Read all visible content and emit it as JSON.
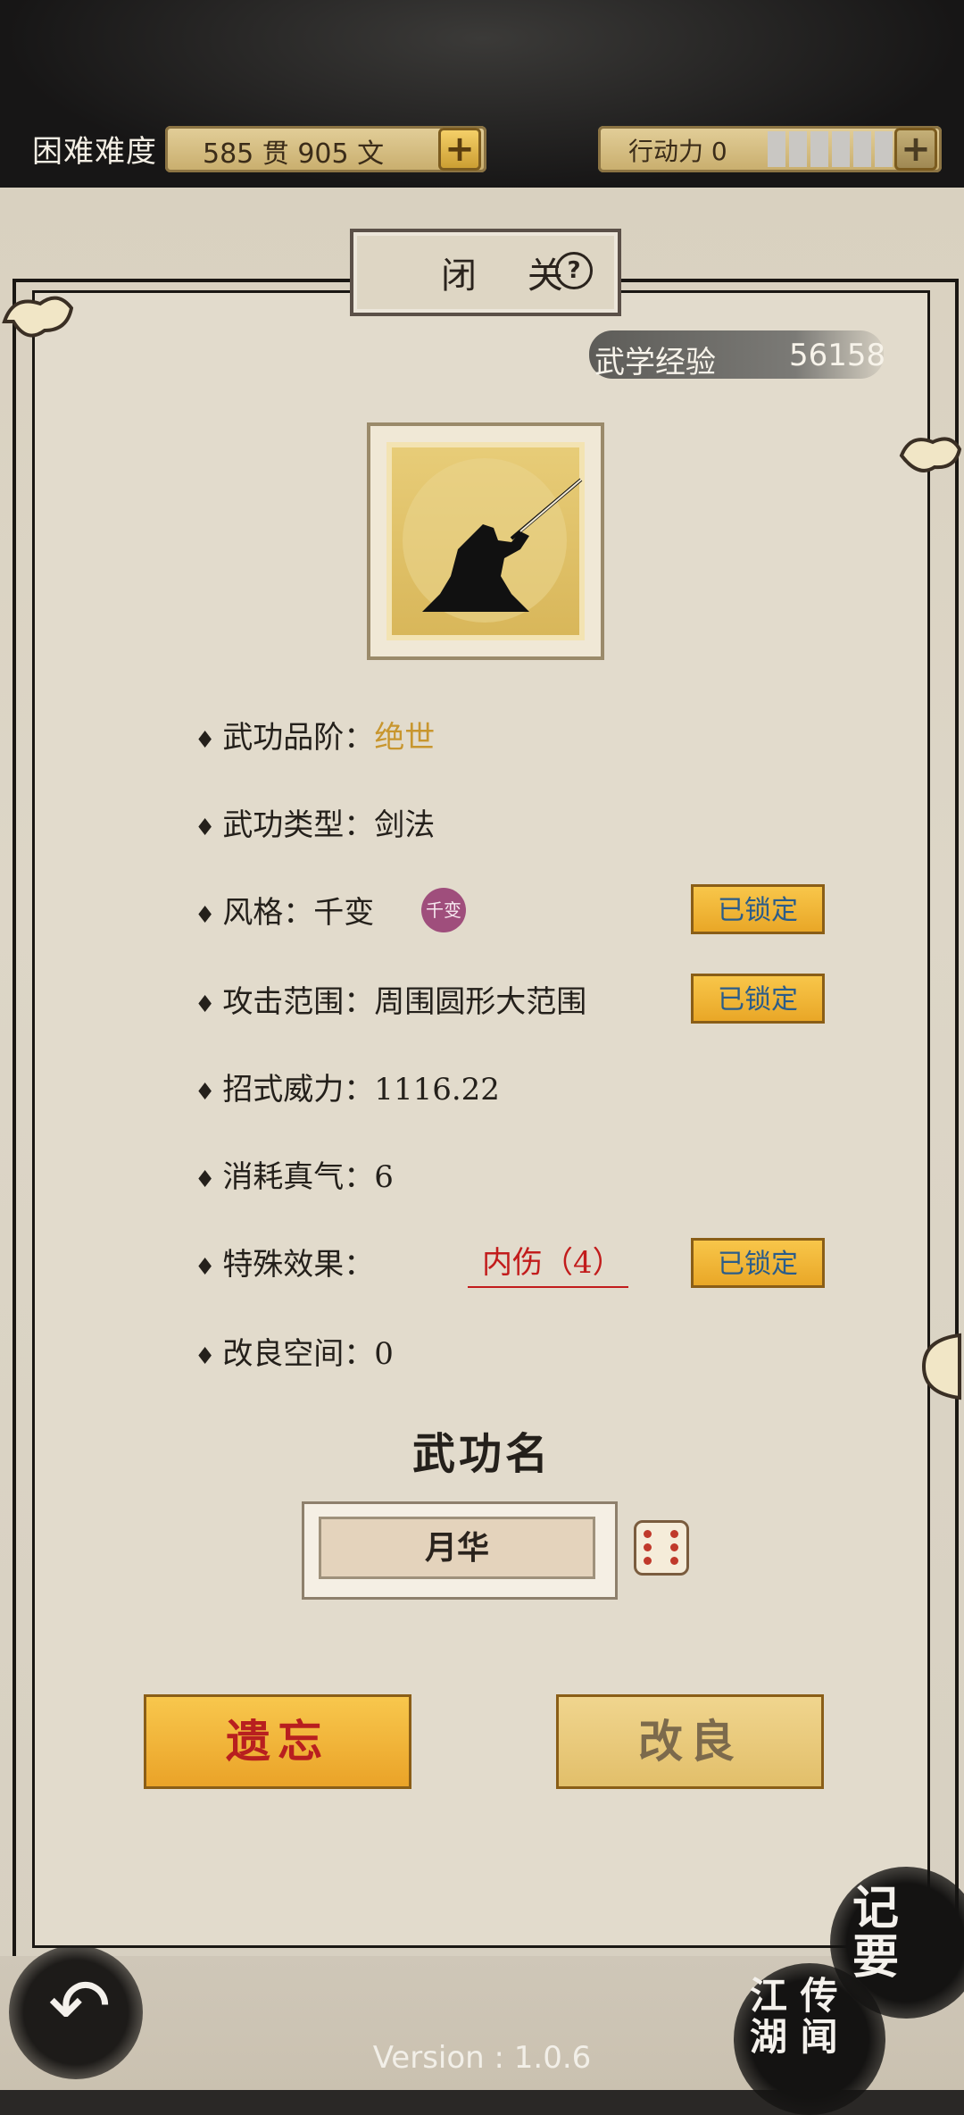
{
  "header": {
    "difficulty": "困难难度",
    "money_text": "585 贯  905  文",
    "action_label": "行动力 0",
    "action_points_fraction": 0
  },
  "panel": {
    "title": "闭 关",
    "exp_label": "武学经验",
    "exp_value": "56158"
  },
  "stats": {
    "grade_label": "武功品阶：",
    "grade_value": "绝世",
    "type_label": "武功类型：剑法",
    "style_label": "风格：千变",
    "style_badge": "千变",
    "range_label": "攻击范围：周围圆形大范围",
    "power_label": "招式威力：1116.22",
    "cost_label": "消耗真气：6",
    "special_label": "特殊效果：",
    "special_value": "内伤（4）",
    "improve_space_label": "改良空间：0",
    "locked_label": "已锁定"
  },
  "skill_name": {
    "title": "武功名",
    "value": "月华"
  },
  "buttons": {
    "forget": "遗忘",
    "improve": "改良"
  },
  "corner": {
    "notes": "记\n要",
    "lore": "江 传\n湖 闻"
  },
  "footer": {
    "version": "Version : 1.0.6"
  },
  "colors": {
    "gold_grade": "#c8962e",
    "lock_button": "#f2b438",
    "special_red": "#c21c1c"
  }
}
